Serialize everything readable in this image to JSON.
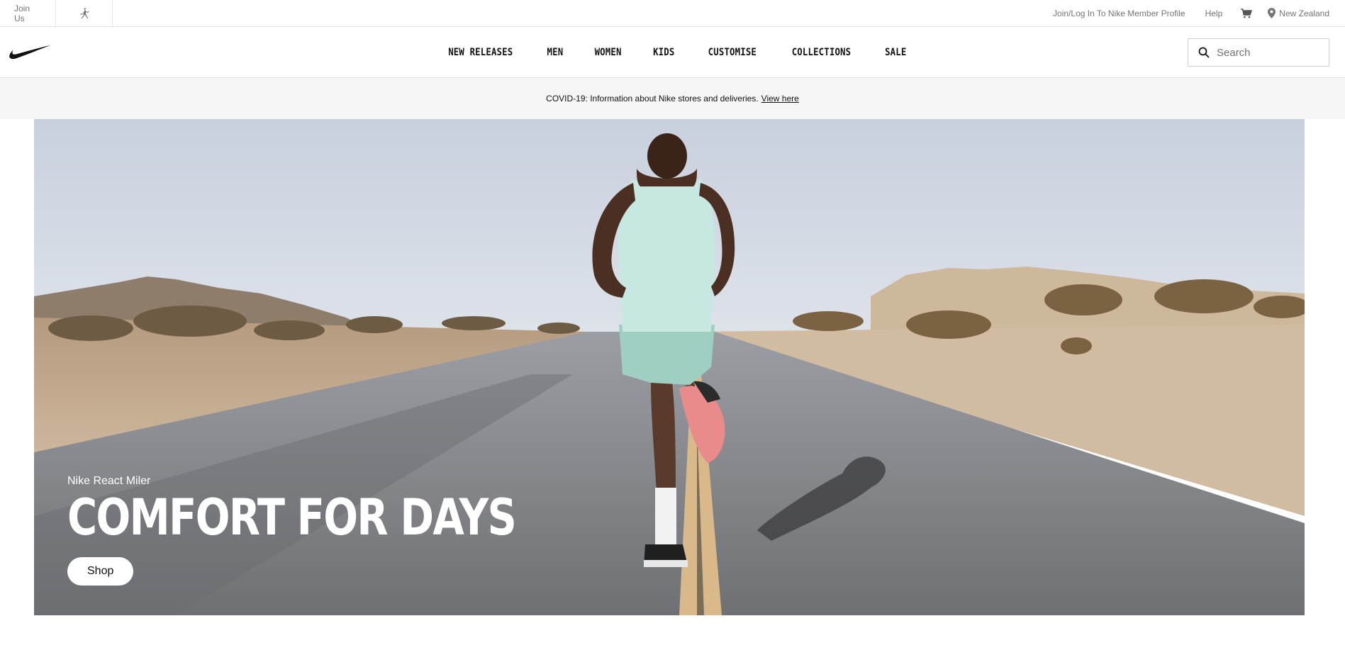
{
  "utility_bar": {
    "join_us": "Join Us",
    "jordan_icon": "jordan-jumpman-icon",
    "profile_link": "Join/Log In To Nike Member Profile",
    "help_link": "Help",
    "cart_icon": "cart-icon",
    "location_icon": "location-pin-icon",
    "region": "New Zealand"
  },
  "header": {
    "logo_icon": "nike-swoosh-icon",
    "nav": [
      {
        "label": "NEW RELEASES"
      },
      {
        "label": "MEN"
      },
      {
        "label": "WOMEN"
      },
      {
        "label": "KIDS"
      },
      {
        "label": "CUSTOMISE"
      },
      {
        "label": "COLLECTIONS"
      },
      {
        "label": "SALE"
      }
    ],
    "search": {
      "placeholder": "Search",
      "icon": "search-icon"
    }
  },
  "notice": {
    "text": "COVID-19: Information about Nike stores and deliveries.",
    "link": "View here"
  },
  "hero": {
    "eyebrow": "Nike React Miler",
    "title": "COMFORT FOR DAYS",
    "button": "Shop"
  },
  "colors": {
    "text": "#111111",
    "muted": "#757575",
    "notice_bg": "#f5f5f5",
    "sky": "#d4dbe7",
    "road": "#8a8a8c",
    "sand": "#c9ad8f"
  }
}
